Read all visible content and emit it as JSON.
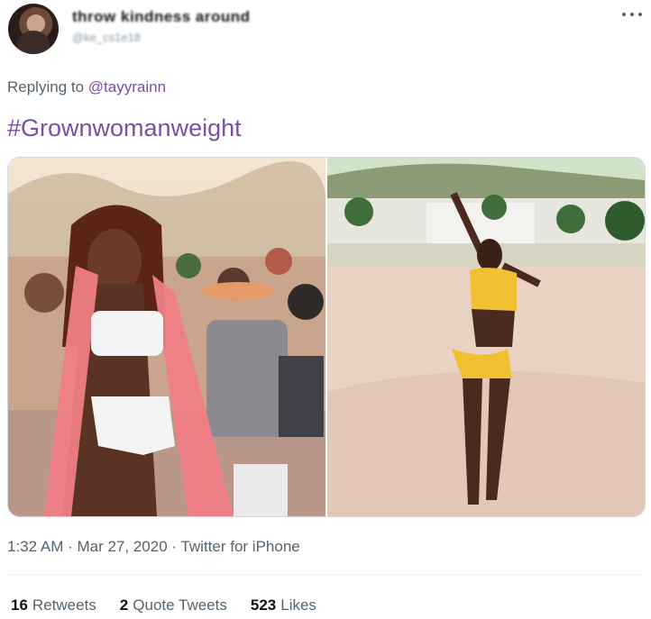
{
  "author": {
    "display_name": "throw kindness around",
    "handle": "@ke_cs1e18"
  },
  "reply": {
    "prefix": "Replying to",
    "mention": "@tayyrainn"
  },
  "tweet": {
    "text": "#Grownwomanweight"
  },
  "meta": {
    "timestamp": "1:32 AM · Mar 27, 2020 · Twitter for iPhone"
  },
  "stats": {
    "retweets_count": "16",
    "retweets_label": "Retweets",
    "quote_count": "2",
    "quote_label": "Quote Tweets",
    "likes_count": "523",
    "likes_label": "Likes"
  },
  "icons": {
    "more": "more-dots-icon"
  },
  "colors": {
    "link": "#7b4ea8",
    "secondary_text": "#536471",
    "border": "#cfd9de"
  }
}
